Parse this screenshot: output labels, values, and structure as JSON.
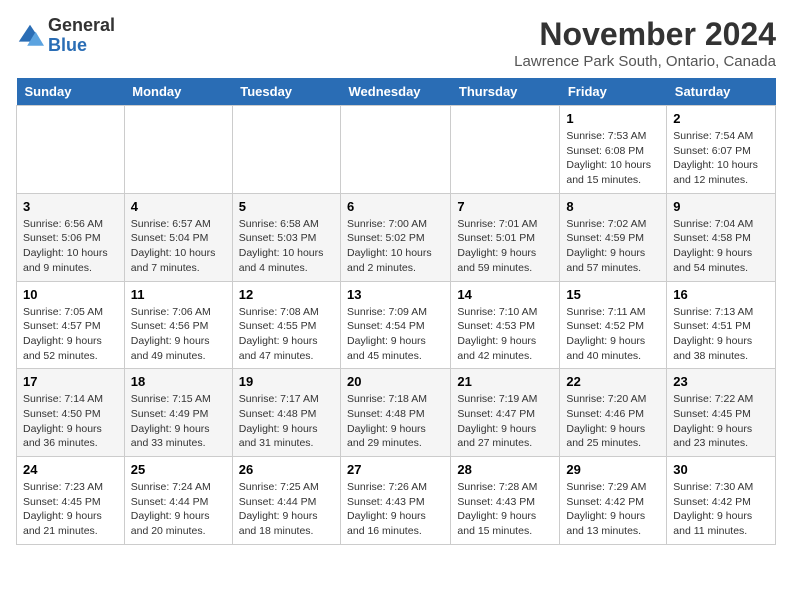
{
  "logo": {
    "text_general": "General",
    "text_blue": "Blue"
  },
  "title": "November 2024",
  "location": "Lawrence Park South, Ontario, Canada",
  "days_of_week": [
    "Sunday",
    "Monday",
    "Tuesday",
    "Wednesday",
    "Thursday",
    "Friday",
    "Saturday"
  ],
  "weeks": [
    [
      {
        "day": "",
        "info": ""
      },
      {
        "day": "",
        "info": ""
      },
      {
        "day": "",
        "info": ""
      },
      {
        "day": "",
        "info": ""
      },
      {
        "day": "",
        "info": ""
      },
      {
        "day": "1",
        "info": "Sunrise: 7:53 AM\nSunset: 6:08 PM\nDaylight: 10 hours and 15 minutes."
      },
      {
        "day": "2",
        "info": "Sunrise: 7:54 AM\nSunset: 6:07 PM\nDaylight: 10 hours and 12 minutes."
      }
    ],
    [
      {
        "day": "3",
        "info": "Sunrise: 6:56 AM\nSunset: 5:06 PM\nDaylight: 10 hours and 9 minutes."
      },
      {
        "day": "4",
        "info": "Sunrise: 6:57 AM\nSunset: 5:04 PM\nDaylight: 10 hours and 7 minutes."
      },
      {
        "day": "5",
        "info": "Sunrise: 6:58 AM\nSunset: 5:03 PM\nDaylight: 10 hours and 4 minutes."
      },
      {
        "day": "6",
        "info": "Sunrise: 7:00 AM\nSunset: 5:02 PM\nDaylight: 10 hours and 2 minutes."
      },
      {
        "day": "7",
        "info": "Sunrise: 7:01 AM\nSunset: 5:01 PM\nDaylight: 9 hours and 59 minutes."
      },
      {
        "day": "8",
        "info": "Sunrise: 7:02 AM\nSunset: 4:59 PM\nDaylight: 9 hours and 57 minutes."
      },
      {
        "day": "9",
        "info": "Sunrise: 7:04 AM\nSunset: 4:58 PM\nDaylight: 9 hours and 54 minutes."
      }
    ],
    [
      {
        "day": "10",
        "info": "Sunrise: 7:05 AM\nSunset: 4:57 PM\nDaylight: 9 hours and 52 minutes."
      },
      {
        "day": "11",
        "info": "Sunrise: 7:06 AM\nSunset: 4:56 PM\nDaylight: 9 hours and 49 minutes."
      },
      {
        "day": "12",
        "info": "Sunrise: 7:08 AM\nSunset: 4:55 PM\nDaylight: 9 hours and 47 minutes."
      },
      {
        "day": "13",
        "info": "Sunrise: 7:09 AM\nSunset: 4:54 PM\nDaylight: 9 hours and 45 minutes."
      },
      {
        "day": "14",
        "info": "Sunrise: 7:10 AM\nSunset: 4:53 PM\nDaylight: 9 hours and 42 minutes."
      },
      {
        "day": "15",
        "info": "Sunrise: 7:11 AM\nSunset: 4:52 PM\nDaylight: 9 hours and 40 minutes."
      },
      {
        "day": "16",
        "info": "Sunrise: 7:13 AM\nSunset: 4:51 PM\nDaylight: 9 hours and 38 minutes."
      }
    ],
    [
      {
        "day": "17",
        "info": "Sunrise: 7:14 AM\nSunset: 4:50 PM\nDaylight: 9 hours and 36 minutes."
      },
      {
        "day": "18",
        "info": "Sunrise: 7:15 AM\nSunset: 4:49 PM\nDaylight: 9 hours and 33 minutes."
      },
      {
        "day": "19",
        "info": "Sunrise: 7:17 AM\nSunset: 4:48 PM\nDaylight: 9 hours and 31 minutes."
      },
      {
        "day": "20",
        "info": "Sunrise: 7:18 AM\nSunset: 4:48 PM\nDaylight: 9 hours and 29 minutes."
      },
      {
        "day": "21",
        "info": "Sunrise: 7:19 AM\nSunset: 4:47 PM\nDaylight: 9 hours and 27 minutes."
      },
      {
        "day": "22",
        "info": "Sunrise: 7:20 AM\nSunset: 4:46 PM\nDaylight: 9 hours and 25 minutes."
      },
      {
        "day": "23",
        "info": "Sunrise: 7:22 AM\nSunset: 4:45 PM\nDaylight: 9 hours and 23 minutes."
      }
    ],
    [
      {
        "day": "24",
        "info": "Sunrise: 7:23 AM\nSunset: 4:45 PM\nDaylight: 9 hours and 21 minutes."
      },
      {
        "day": "25",
        "info": "Sunrise: 7:24 AM\nSunset: 4:44 PM\nDaylight: 9 hours and 20 minutes."
      },
      {
        "day": "26",
        "info": "Sunrise: 7:25 AM\nSunset: 4:44 PM\nDaylight: 9 hours and 18 minutes."
      },
      {
        "day": "27",
        "info": "Sunrise: 7:26 AM\nSunset: 4:43 PM\nDaylight: 9 hours and 16 minutes."
      },
      {
        "day": "28",
        "info": "Sunrise: 7:28 AM\nSunset: 4:43 PM\nDaylight: 9 hours and 15 minutes."
      },
      {
        "day": "29",
        "info": "Sunrise: 7:29 AM\nSunset: 4:42 PM\nDaylight: 9 hours and 13 minutes."
      },
      {
        "day": "30",
        "info": "Sunrise: 7:30 AM\nSunset: 4:42 PM\nDaylight: 9 hours and 11 minutes."
      }
    ]
  ]
}
